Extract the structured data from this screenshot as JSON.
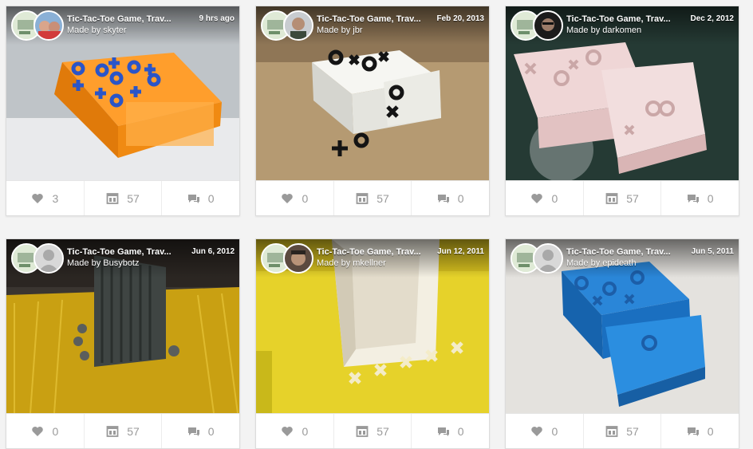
{
  "cards": [
    {
      "title": "Tic-Tac-Toe Game, Trav...",
      "maker": "Made by skyter",
      "date": "9 hrs ago",
      "likes": "3",
      "collections": "57",
      "comments": "0"
    },
    {
      "title": "Tic-Tac-Toe Game, Trav...",
      "maker": "Made by jbr",
      "date": "Feb 20, 2013",
      "likes": "0",
      "collections": "57",
      "comments": "0"
    },
    {
      "title": "Tic-Tac-Toe Game, Trav...",
      "maker": "Made by darkomen",
      "date": "Dec 2, 2012",
      "likes": "0",
      "collections": "57",
      "comments": "0"
    },
    {
      "title": "Tic-Tac-Toe Game, Trav...",
      "maker": "Made by Busybotz",
      "date": "Jun 6, 2012",
      "likes": "0",
      "collections": "57",
      "comments": "0"
    },
    {
      "title": "Tic-Tac-Toe Game, Trav...",
      "maker": "Made by mkellner",
      "date": "Jun 12, 2011",
      "likes": "0",
      "collections": "57",
      "comments": "0"
    },
    {
      "title": "Tic-Tac-Toe Game, Trav...",
      "maker": "Made by epideath",
      "date": "Jun 5, 2011",
      "likes": "0",
      "collections": "57",
      "comments": "0"
    }
  ],
  "icons": {
    "like": "heart-icon",
    "collect": "collection-icon",
    "comment": "comment-icon"
  },
  "colors": {
    "stat_text": "#9a9a9a",
    "header_text": "#ffffff"
  }
}
